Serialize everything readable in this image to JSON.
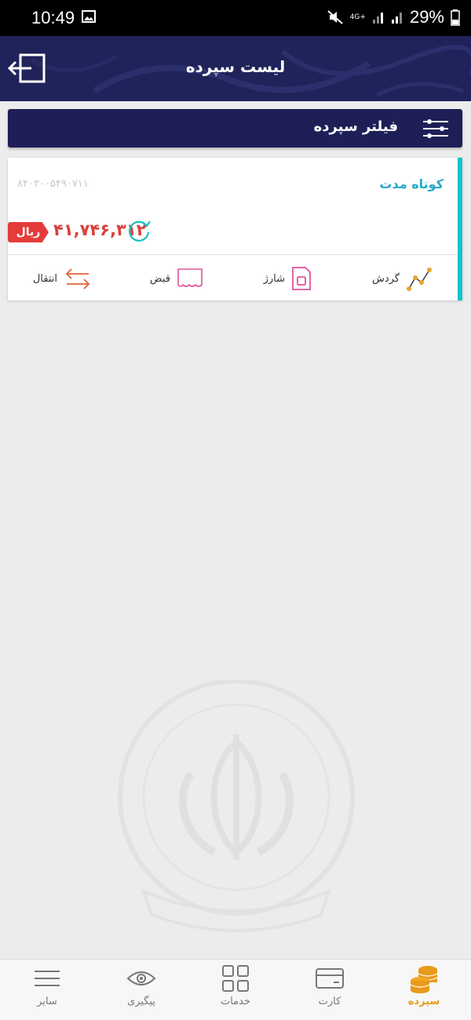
{
  "status_bar": {
    "time": "10:49",
    "network": "4G+",
    "battery": "29%"
  },
  "header": {
    "title": "لیست سپرده"
  },
  "filter": {
    "label": "فیلتر سپرده"
  },
  "deposit": {
    "type": "کوتاه مدت",
    "account_number": "۸۴۰۳۰۰۵۴۹۰۷۱۱",
    "balance": "۴۱,۷۴۶,۳۱۲",
    "currency": "ریال",
    "actions": [
      {
        "label": "گردش",
        "icon": "turnover-chart-icon"
      },
      {
        "label": "شارژ",
        "icon": "sim-card-icon"
      },
      {
        "label": "قبض",
        "icon": "bill-icon"
      },
      {
        "label": "انتقال",
        "icon": "transfer-arrows-icon"
      }
    ]
  },
  "bottom_nav": {
    "items": [
      {
        "label": "سپرده",
        "icon": "coins-stack-icon",
        "active": true
      },
      {
        "label": "کارت",
        "icon": "card-icon",
        "active": false
      },
      {
        "label": "خدمات",
        "icon": "grid-icon",
        "active": false
      },
      {
        "label": "پیگیری",
        "icon": "eye-icon",
        "active": false
      },
      {
        "label": "سایر",
        "icon": "menu-icon",
        "active": false
      }
    ]
  },
  "colors": {
    "header_bg": "#20235a",
    "filter_bg": "#1f1f57",
    "card_accent": "#15c3c9",
    "balance": "#d9423c",
    "active_nav": "#e89a1b"
  }
}
